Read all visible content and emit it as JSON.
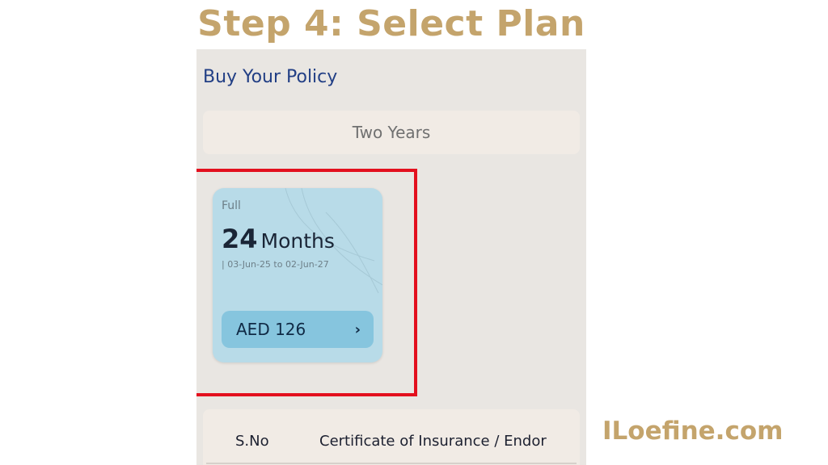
{
  "header": {
    "title": "Step 4: Select Plan"
  },
  "screen": {
    "title": "Buy Your Policy",
    "duration_option": "Two Years",
    "plan": {
      "type": "Full",
      "duration_number": "24",
      "duration_unit": "Months",
      "dates": "| 03-Jun-25 to 02-Jun-27",
      "price": "AED 126",
      "price_icon": "chevron-right-icon"
    },
    "table": {
      "columns": [
        "S.No",
        "Certificate of Insurance / Endor"
      ]
    }
  },
  "watermark": "ILoefine.com",
  "colors": {
    "title_accent": "#c4a46c",
    "highlight_border": "#e3101e",
    "card_bg": "#b8dbe8",
    "button_bg": "#86c5de",
    "link_blue": "#223f85"
  }
}
